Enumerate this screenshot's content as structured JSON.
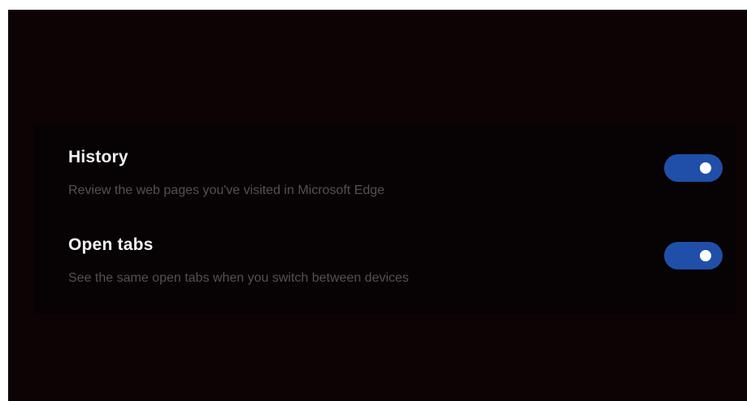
{
  "settings": {
    "items": [
      {
        "title": "History",
        "description": "Review the web pages you've visited in Microsoft Edge",
        "enabled": true
      },
      {
        "title": "Open tabs",
        "description": "See the same open tabs when you switch between devices",
        "enabled": true
      }
    ]
  },
  "colors": {
    "background": "#0d0204",
    "panel": "#070203",
    "toggle_on": "#1f4fa8",
    "title_text": "#f2f2f2",
    "description_text": "#555052"
  }
}
